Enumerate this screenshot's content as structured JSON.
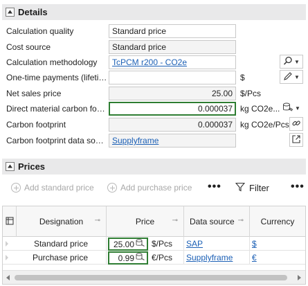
{
  "details": {
    "title": "Details",
    "fields": [
      {
        "label": "Calculation quality",
        "value": "Standard price",
        "unit": ""
      },
      {
        "label": "Cost source",
        "value": "Standard price",
        "unit": ""
      },
      {
        "label": "Calculation methodology",
        "value": "TcPCM r200 - CO2e",
        "unit": ""
      },
      {
        "label": "One-time payments (lifetime)",
        "value": "",
        "unit": "$"
      },
      {
        "label": "Net sales price",
        "value": "25.00",
        "unit": "$/Pcs"
      },
      {
        "label": "Direct material carbon footprint",
        "value": "0.000037",
        "unit": "kg CO2e..."
      },
      {
        "label": "Carbon footprint",
        "value": "0.000037",
        "unit": "kg CO2e/Pcs"
      },
      {
        "label": "Carbon footprint data source",
        "value": "Supplyframe",
        "unit": ""
      }
    ]
  },
  "prices": {
    "title": "Prices",
    "toolbar": {
      "add_standard": "Add standard price",
      "add_purchase": "Add purchase price",
      "more": "•••",
      "filter": "Filter",
      "more2": "•••"
    },
    "columns": [
      "Designation",
      "Price",
      "Data source",
      "Currency"
    ],
    "rows": [
      {
        "designation": "Standard price",
        "price": "25.00",
        "unit": "$/Pcs",
        "data_source": "SAP",
        "currency": "$"
      },
      {
        "designation": "Purchase price",
        "price": "0.99",
        "unit": "€/Pcs",
        "data_source": "Supplyframe",
        "currency": "€"
      }
    ]
  },
  "colors": {
    "accent_green": "#2e7d32",
    "link_blue": "#1b5fb5",
    "header_bg": "#e9e9ea"
  }
}
